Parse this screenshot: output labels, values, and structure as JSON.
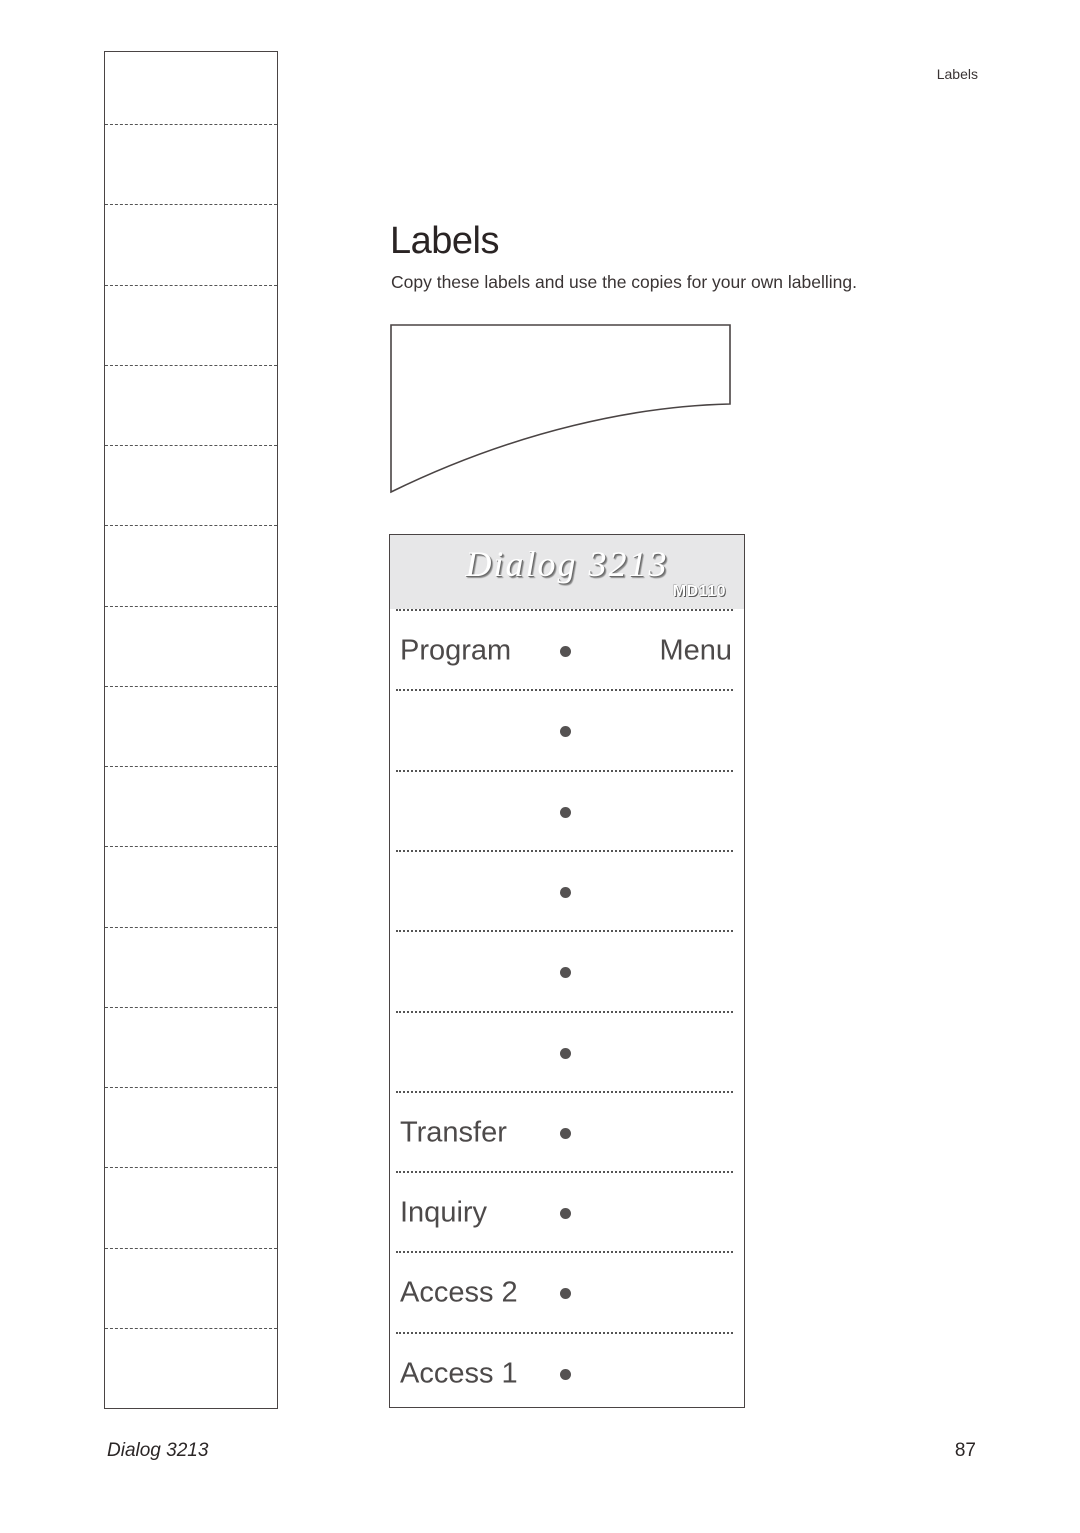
{
  "running_head": "Labels",
  "page": {
    "title": "Labels",
    "intro": "Copy these labels and use the copies for your own labelling."
  },
  "blank_strip": {
    "cell_count": 17
  },
  "card": {
    "brand": "Dialog 3213",
    "model": "MD110",
    "rows": [
      {
        "left": "Program",
        "right": "Menu"
      },
      {
        "left": "",
        "right": ""
      },
      {
        "left": "",
        "right": ""
      },
      {
        "left": "",
        "right": ""
      },
      {
        "left": "",
        "right": ""
      },
      {
        "left": "",
        "right": ""
      },
      {
        "left": "Transfer",
        "right": ""
      },
      {
        "left": "Inquiry",
        "right": ""
      },
      {
        "left": "Access 2",
        "right": ""
      },
      {
        "left": "Access 1",
        "right": ""
      }
    ]
  },
  "footer": {
    "product": "Dialog 3213",
    "page_number": "87"
  },
  "colors": {
    "border": "#4a4444",
    "header_bg": "#e7e7e8",
    "key_text": "#4d4a4a"
  }
}
